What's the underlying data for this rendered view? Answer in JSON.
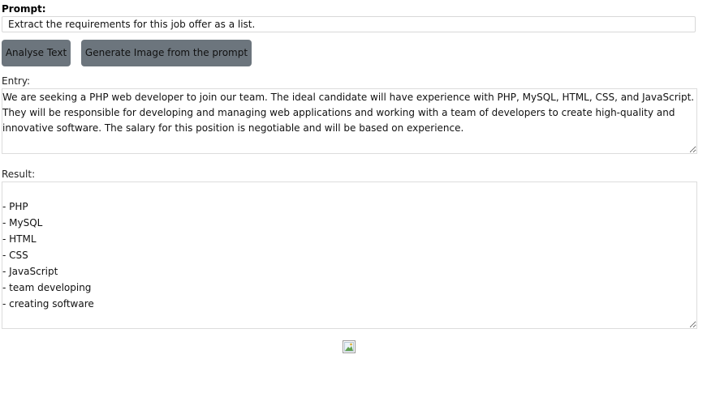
{
  "prompt": {
    "label": "Prompt:",
    "value": "Extract the requirements for this job offer as a list."
  },
  "buttons": {
    "analyse": "Analyse Text",
    "generate": "Generate Image from the prompt"
  },
  "entry": {
    "label": "Entry:",
    "value": "We are seeking a PHP web developer to join our team. The ideal candidate will have experience with PHP, MySQL, HTML, CSS, and JavaScript. They will be responsible for developing and managing web applications and working with a team of developers to create high-quality and innovative software. The salary for this position is negotiable and will be based on experience."
  },
  "result": {
    "label": "Result:",
    "value": "- PHP\n- MySQL\n- HTML\n- CSS\n- JavaScript\n- team developing\n- creating software"
  },
  "image": {
    "icon": "broken-image-icon"
  }
}
